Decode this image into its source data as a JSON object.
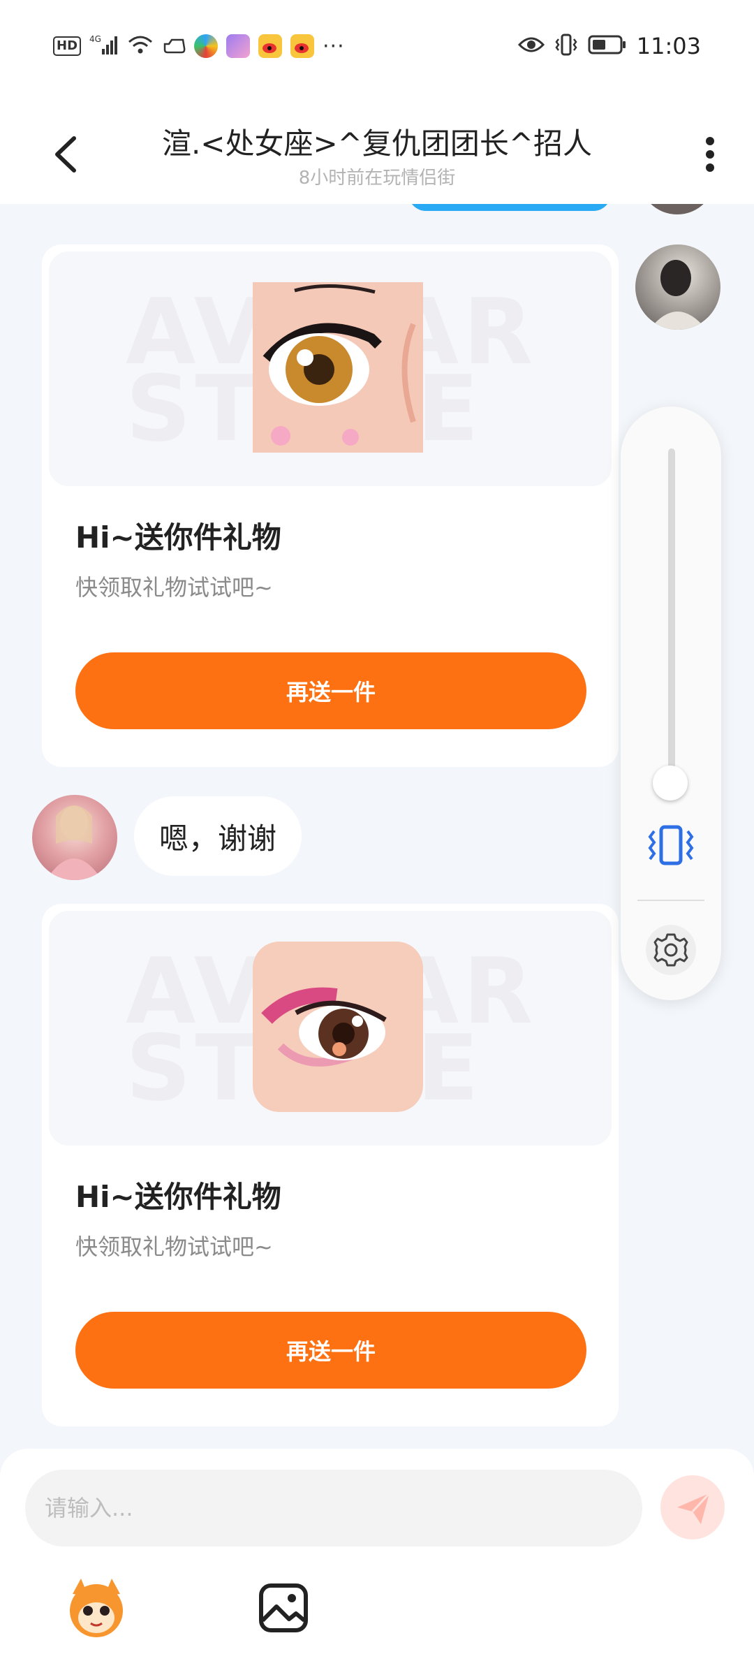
{
  "status_bar": {
    "hd": "HD",
    "network": "4G",
    "more": "···",
    "time": "11:03",
    "icons": [
      "hd-icon",
      "signal-icon",
      "wifi-icon",
      "cloud-icon",
      "app-icon",
      "app-icon",
      "weibo-icon",
      "weibo-icon",
      "eye-icon",
      "vibrate-icon",
      "battery-icon"
    ]
  },
  "header": {
    "title": "渲.<处女座>^复仇团团长^招人",
    "subtitle": "8小时前在玩情侣街"
  },
  "gift_cards": [
    {
      "title": "Hi~送你件礼物",
      "desc": "快领取礼物试试吧~",
      "button": "再送一件",
      "watermark": "AVATAR STORE"
    },
    {
      "title": "Hi~送你件礼物",
      "desc": "快领取礼物试试吧~",
      "button": "再送一件",
      "watermark": "AVATAR STORE"
    }
  ],
  "reply": {
    "text": "嗯，谢谢"
  },
  "volume_panel": {
    "level": 0.05,
    "accent": "#2f6fe6"
  },
  "input": {
    "placeholder": "请输入..."
  },
  "colors": {
    "accent_orange": "#fe7112",
    "bubble_blue": "#2aa9f5",
    "send_tint": "#ffe3df"
  }
}
